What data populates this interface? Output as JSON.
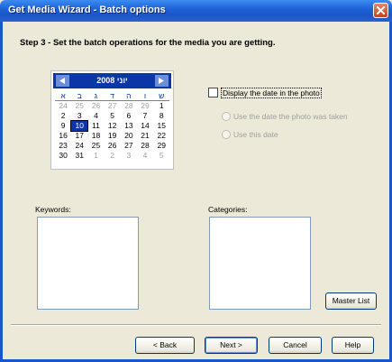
{
  "window": {
    "title": "Get Media Wizard - Batch options"
  },
  "step": {
    "text": "Step 3 - Set the batch operations for the media you are getting."
  },
  "calendar": {
    "month_label": "2008 יוני",
    "days_of_week": [
      "א",
      "ב",
      "ג",
      "ד",
      "ה",
      "ו",
      "ש"
    ],
    "weeks": [
      [
        {
          "d": "24",
          "o": true
        },
        {
          "d": "25",
          "o": true
        },
        {
          "d": "26",
          "o": true
        },
        {
          "d": "27",
          "o": true
        },
        {
          "d": "28",
          "o": true
        },
        {
          "d": "29",
          "o": true
        },
        {
          "d": "1",
          "o": false
        }
      ],
      [
        {
          "d": "2",
          "o": false
        },
        {
          "d": "3",
          "o": false
        },
        {
          "d": "4",
          "o": false
        },
        {
          "d": "5",
          "o": false
        },
        {
          "d": "6",
          "o": false
        },
        {
          "d": "7",
          "o": false
        },
        {
          "d": "8",
          "o": false
        }
      ],
      [
        {
          "d": "9",
          "o": false
        },
        {
          "d": "10",
          "o": false,
          "sel": true
        },
        {
          "d": "11",
          "o": false
        },
        {
          "d": "12",
          "o": false
        },
        {
          "d": "13",
          "o": false
        },
        {
          "d": "14",
          "o": false
        },
        {
          "d": "15",
          "o": false
        }
      ],
      [
        {
          "d": "16",
          "o": false
        },
        {
          "d": "17",
          "o": false
        },
        {
          "d": "18",
          "o": false
        },
        {
          "d": "19",
          "o": false
        },
        {
          "d": "20",
          "o": false
        },
        {
          "d": "21",
          "o": false
        },
        {
          "d": "22",
          "o": false
        }
      ],
      [
        {
          "d": "23",
          "o": false
        },
        {
          "d": "24",
          "o": false
        },
        {
          "d": "25",
          "o": false
        },
        {
          "d": "26",
          "o": false
        },
        {
          "d": "27",
          "o": false
        },
        {
          "d": "28",
          "o": false
        },
        {
          "d": "29",
          "o": false
        }
      ],
      [
        {
          "d": "30",
          "o": false
        },
        {
          "d": "31",
          "o": false
        },
        {
          "d": "1",
          "o": true
        },
        {
          "d": "2",
          "o": true
        },
        {
          "d": "3",
          "o": true
        },
        {
          "d": "4",
          "o": true
        },
        {
          "d": "5",
          "o": true
        }
      ]
    ]
  },
  "options": {
    "display_date_label": "Display the date in the photo",
    "display_date_checked": false,
    "radio_taken_label": "Use the date the photo was taken",
    "radio_this_label": "Use this date"
  },
  "keywords": {
    "label": "Keywords:"
  },
  "categories": {
    "label": "Categories:"
  },
  "buttons": {
    "master_list": "Master List",
    "back": "< Back",
    "next": "Next >",
    "cancel": "Cancel",
    "help": "Help"
  },
  "colors": {
    "title_bar": "#1f63d8",
    "calendar_header": "#0a36a6",
    "selected_day": "#0a36a6",
    "close_button": "#c6421f"
  },
  "icons": {
    "close": "close-icon",
    "prev_month": "chevron-left-icon",
    "next_month": "chevron-right-icon"
  }
}
